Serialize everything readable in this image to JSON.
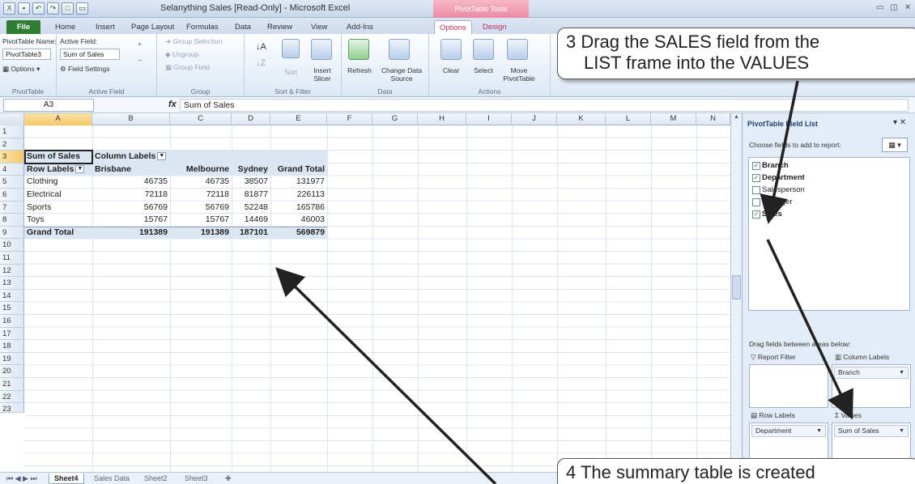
{
  "title_bar": {
    "document_title": "Selanything Sales [Read-Only] - Microsoft Excel",
    "context_label": "PivotTable Tools"
  },
  "ribbon_tabs": [
    "File",
    "Home",
    "Insert",
    "Page Layout",
    "Formulas",
    "Data",
    "Review",
    "View",
    "Add-Ins",
    "Options",
    "Design"
  ],
  "ribbon": {
    "pivottable_name_label": "PivotTable Name:",
    "pivottable_name_value": "PivotTable3",
    "options_label": "Options",
    "pivottable_group": "PivotTable",
    "active_field_label": "Active Field:",
    "active_field_value": "Sum of Sales",
    "field_settings_label": "Field Settings",
    "active_field_group": "Active Field",
    "group_selection": "Group Selection",
    "ungroup": "Ungroup",
    "group_field": "Group Field",
    "group_group": "Group",
    "sort_label": "Sort",
    "insert_slicer": "Insert Slicer",
    "sort_filter_group": "Sort & Filter",
    "refresh": "Refresh",
    "change_data_source": "Change Data Source",
    "data_group": "Data",
    "clear": "Clear",
    "select": "Select",
    "move_pivottable": "Move PivotTable",
    "actions_group": "Actions"
  },
  "formula_bar": {
    "name_box": "A3",
    "fx": "fx",
    "content": "Sum of Sales"
  },
  "columns": [
    "A",
    "B",
    "C",
    "D",
    "E",
    "F",
    "G",
    "H",
    "I",
    "J",
    "K",
    "L",
    "M",
    "N"
  ],
  "rows": [
    "1",
    "2",
    "3",
    "4",
    "5",
    "6",
    "7",
    "8",
    "9",
    "10",
    "11",
    "12",
    "13",
    "14",
    "15",
    "16",
    "17",
    "18",
    "19",
    "20",
    "21",
    "22",
    "23"
  ],
  "pivot": {
    "corner_label": "Sum of Sales",
    "column_labels": "Column Labels",
    "row_labels": "Row Labels",
    "headers": [
      "Brisbane",
      "Melbourne",
      "Sydney",
      "Grand Total"
    ],
    "rows": [
      {
        "label": "Clothing",
        "values": [
          "46735",
          "46735",
          "38507",
          "131977"
        ]
      },
      {
        "label": "Electrical",
        "values": [
          "72118",
          "72118",
          "81877",
          "226113"
        ]
      },
      {
        "label": "Sports",
        "values": [
          "56769",
          "56769",
          "52248",
          "165786"
        ]
      },
      {
        "label": "Toys",
        "values": [
          "15767",
          "15767",
          "14469",
          "46003"
        ]
      }
    ],
    "grand_total": {
      "label": "Grand Total",
      "values": [
        "191389",
        "191389",
        "187101",
        "569879"
      ]
    }
  },
  "sheet_tabs": [
    "Sheet4",
    "Sales Data",
    "Sheet2",
    "Sheet3"
  ],
  "field_list": {
    "title": "PivotTable Field List",
    "choose_label": "Choose fields to add to report:",
    "fields": [
      {
        "name": "Branch",
        "checked": true,
        "bold": true
      },
      {
        "name": "Department",
        "checked": true,
        "bold": true
      },
      {
        "name": "Salesperson",
        "checked": false,
        "bold": false
      },
      {
        "name": "Manager",
        "checked": false,
        "bold": false
      },
      {
        "name": "Sales",
        "checked": true,
        "bold": true
      }
    ],
    "drag_label": "Drag fields between areas below:",
    "report_filter": "Report Filter",
    "column_labels": "Column Labels",
    "column_value": "Branch",
    "row_labels": "Row Labels",
    "row_value": "Department",
    "values": "Values",
    "values_value": "Sum of Sales"
  },
  "callouts": {
    "step3_line1": "3  Drag the SALES field from the",
    "step3_line2": "LIST frame into the VALUES",
    "step4_line1": "4  The summary table is created"
  },
  "colors": {
    "pivot_header_band": "#dce6f2",
    "pivot_tools_tab": "#ec8aa2",
    "file_tab": "#2e7d32"
  }
}
